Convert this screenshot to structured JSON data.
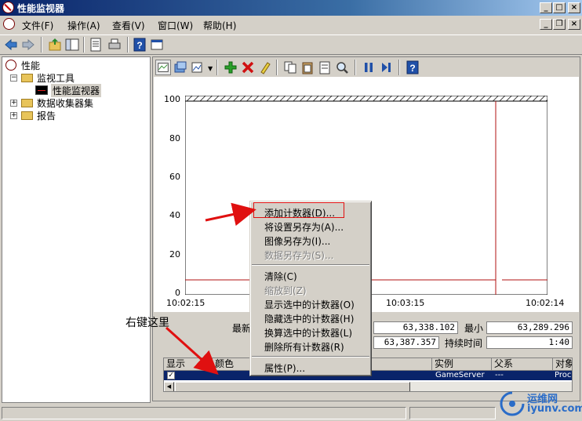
{
  "window": {
    "title": "性能监视器"
  },
  "menu": [
    {
      "label": "文件(F)"
    },
    {
      "label": "操作(A)"
    },
    {
      "label": "查看(V)"
    },
    {
      "label": "窗口(W)"
    },
    {
      "label": "帮助(H)"
    }
  ],
  "tree": {
    "root": "性能",
    "tools": "监视工具",
    "perfmon": "性能监视器",
    "collector_sets": "数据收集器集",
    "reports": "报告"
  },
  "graph": {
    "y_ticks": [
      "100",
      "80",
      "60",
      "40",
      "20",
      "0"
    ],
    "x_ticks": [
      "10:02:15",
      "10:03:15",
      "10:02:14"
    ]
  },
  "stats": {
    "last_label": "最新",
    "last_value": "63,338.102",
    "min_label": "最小",
    "min_value": "63,289.296",
    "max_value": "63,387.357",
    "duration_label": "持续时间",
    "duration_value": "1:40"
  },
  "table": {
    "headers": [
      "显示",
      "颜色",
      "实例",
      "父系",
      "对象"
    ],
    "row": {
      "instance": "GameServer",
      "parent": "---",
      "object": "Proc"
    }
  },
  "context_menu": [
    {
      "label": "添加计数器(D)...",
      "enabled": true
    },
    {
      "label": "将设置另存为(A)...",
      "enabled": true
    },
    {
      "label": "图像另存为(I)...",
      "enabled": true
    },
    {
      "label": "数据另存为(S)...",
      "enabled": false
    },
    {
      "label": "清除(C)",
      "enabled": true
    },
    {
      "label": "缩放到(Z)",
      "enabled": false
    },
    {
      "label": "显示选中的计数器(O)",
      "enabled": true
    },
    {
      "label": "隐藏选中的计数器(H)",
      "enabled": true
    },
    {
      "label": "换算选中的计数器(L)",
      "enabled": true
    },
    {
      "label": "删除所有计数器(R)",
      "enabled": true
    },
    {
      "label": "属性(P)...",
      "enabled": true
    }
  ],
  "annotation": {
    "text": "右键这里",
    "color": "#e01010"
  },
  "watermark": {
    "name": "运维网",
    "url": "iyunv.com"
  },
  "colors": {
    "titlebar": "#0a246a",
    "highlight": "#0a246a",
    "line": "#b01010",
    "accent": "#e01010"
  }
}
